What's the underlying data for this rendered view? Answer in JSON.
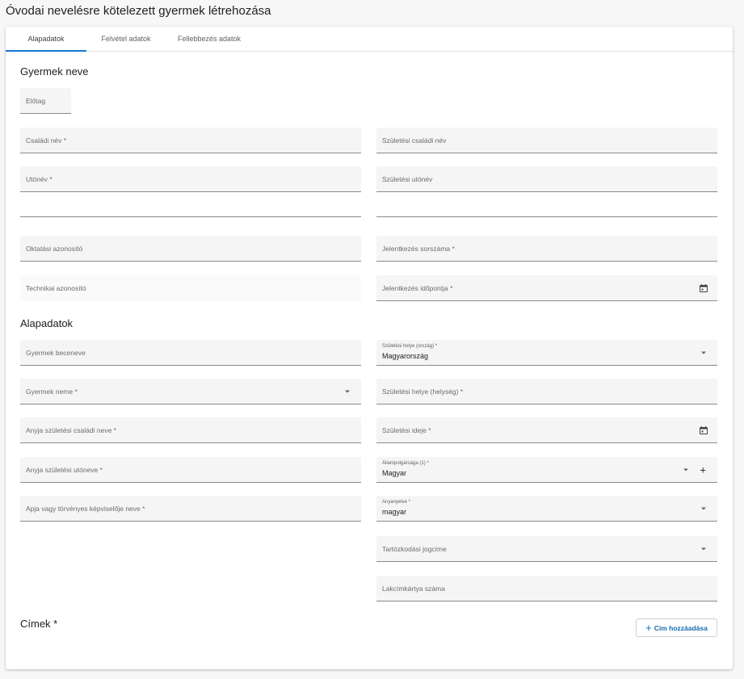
{
  "page_title": "Óvodai nevelésre kötelezett gyermek létrehozása",
  "tabs": [
    {
      "label": "Alapadatok",
      "active": true
    },
    {
      "label": "Felvétel adatok",
      "active": false
    },
    {
      "label": "Fellebbezés adatok",
      "active": false
    }
  ],
  "sections": {
    "name": "Gyermek neve",
    "basic": "Alapadatok",
    "addresses": "Címek *"
  },
  "fields": {
    "prefix": "Előtag",
    "family_name": "Családi név *",
    "birth_family_name": "Születési családi név",
    "given_name": "Utónév *",
    "birth_given_name": "Születési utónév",
    "edu_id": "Oktatási azonosító",
    "application_no": "Jelentkezés sorszáma *",
    "technical_id": "Technikai azonosító",
    "application_time": "Jelentkezés időpontja *",
    "nickname": "Gyermek beceneve",
    "birth_country_label": "Születési helye (ország) *",
    "birth_country_value": "Magyarország",
    "gender": "Gyermek neme *",
    "birth_place": "Születési helye (helység) *",
    "mother_family_name": "Anyja születési családi neve *",
    "birth_date": "Születési ideje *",
    "mother_given_name": "Anyja születési utóneve *",
    "citizenship_label": "Állampolgársága (1) *",
    "citizenship_value": "Magyar",
    "father_name": "Apja vagy törvényes képviselője neve *",
    "mother_tongue_label": "Anyanyelve *",
    "mother_tongue_value": "magyar",
    "residence_title": "Tartózkodási jogcíme",
    "address_card_no": "Lakcímkártya száma"
  },
  "buttons": {
    "add_address": "Cím hozzáadása"
  },
  "colors": {
    "accent": "#1976d2",
    "field_bg": "#f5f5f5"
  }
}
